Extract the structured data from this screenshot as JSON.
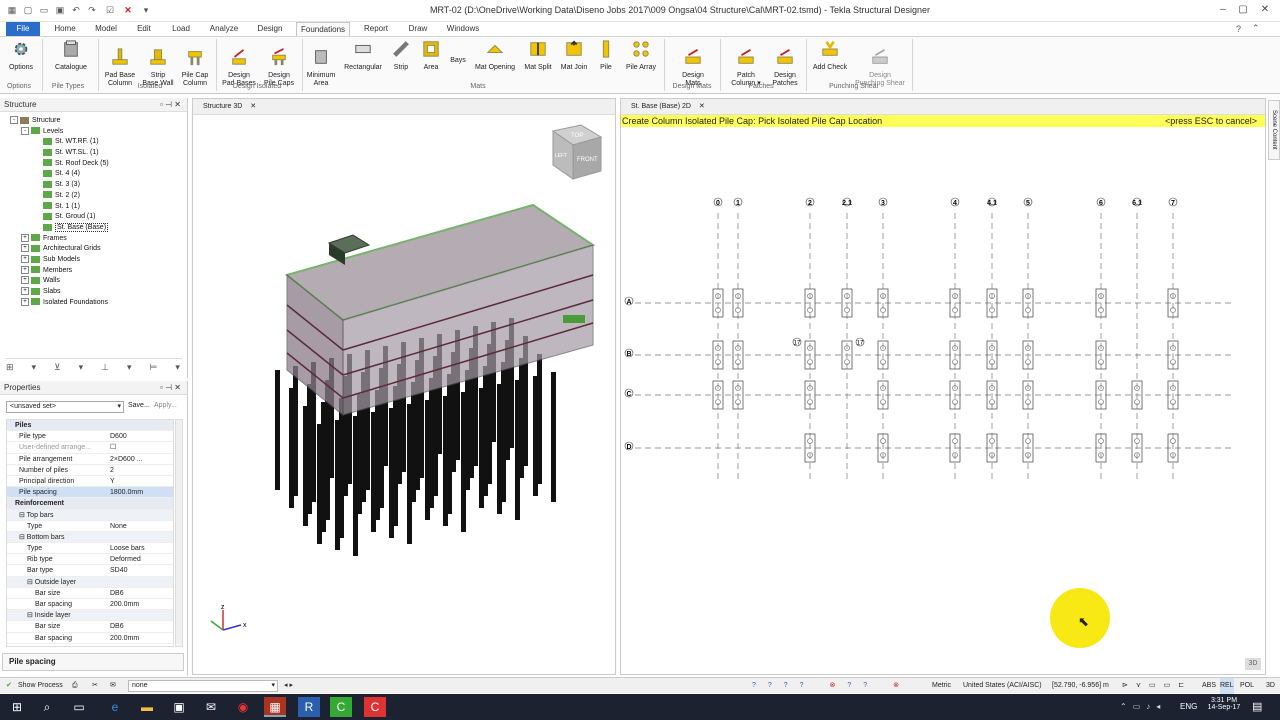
{
  "window": {
    "title": "MRT-02 (D:\\OneDrive\\Working Data\\Diseno Jobs 2017\\009 Ongsa\\04 Structure\\Cal\\MRT-02.tsmd) - Tekla Structural Designer"
  },
  "menu": {
    "tabs": [
      "File",
      "Home",
      "Model",
      "Edit",
      "Load",
      "Analyze",
      "Design",
      "Foundations",
      "Report",
      "Draw",
      "Windows"
    ],
    "active": "Foundations"
  },
  "ribbon": {
    "buttons": [
      {
        "label": "Options",
        "icon": "gear-icon"
      },
      {
        "label": "Catalogue",
        "icon": "catalogue-icon"
      },
      {
        "label": "Pad Base\nColumn",
        "icon": "pad-base-icon"
      },
      {
        "label": "Strip\nBase Wall",
        "icon": "strip-base-icon"
      },
      {
        "label": "Pile Cap\nColumn",
        "icon": "pile-cap-icon"
      },
      {
        "label": "Design\nPad Bases",
        "icon": "design-pad-icon"
      },
      {
        "label": "Design\nPile Caps",
        "icon": "design-pile-icon"
      },
      {
        "label": "Minimum\nArea",
        "icon": "minimum-area-icon"
      },
      {
        "label": "Rectangular",
        "icon": "rectangular-icon"
      },
      {
        "label": "Strip",
        "icon": "strip-icon"
      },
      {
        "label": "Area",
        "icon": "area-icon"
      },
      {
        "label": "Bays",
        "icon": "bays-icon"
      },
      {
        "label": "Mat Opening",
        "icon": "mat-opening-icon"
      },
      {
        "label": "Mat Split",
        "icon": "mat-split-icon"
      },
      {
        "label": "Mat Join",
        "icon": "mat-join-icon"
      },
      {
        "label": "Pile",
        "icon": "pile-icon"
      },
      {
        "label": "Pile Array",
        "icon": "pile-array-icon"
      },
      {
        "label": "Design\nMats",
        "icon": "design-mats-icon"
      },
      {
        "label": "Patch\nColumn ▾",
        "icon": "patch-column-icon"
      },
      {
        "label": "Design\nPatches",
        "icon": "design-patches-icon"
      },
      {
        "label": "Add Check",
        "icon": "add-check-icon"
      },
      {
        "label": "Design\nPunching Shear",
        "icon": "design-punching-icon"
      }
    ],
    "groups": [
      "Options",
      "Pile Types",
      "Isolated",
      "Design Isolated",
      "Mats",
      "Design Mats",
      "Patches",
      "Punching Shear"
    ]
  },
  "structure_panel": {
    "title": "Structure",
    "tree": [
      {
        "label": "Structure",
        "level": 0,
        "toggle": "-"
      },
      {
        "label": "Levels",
        "level": 1,
        "toggle": "-"
      },
      {
        "label": "St. WT.RF. (1)",
        "level": 2
      },
      {
        "label": "St. WT.SL. (1)",
        "level": 2
      },
      {
        "label": "St. Roof Deck (5)",
        "level": 2
      },
      {
        "label": "St. 4 (4)",
        "level": 2
      },
      {
        "label": "St. 3 (3)",
        "level": 2
      },
      {
        "label": "St. 2 (2)",
        "level": 2
      },
      {
        "label": "St. 1 (1)",
        "level": 2
      },
      {
        "label": "St. Groud (1)",
        "level": 2
      },
      {
        "label": "St. Base (Base)",
        "level": 2,
        "selected": true
      },
      {
        "label": "Frames",
        "level": 1,
        "toggle": "+"
      },
      {
        "label": "Architectural Grids",
        "level": 1,
        "toggle": "+"
      },
      {
        "label": "Sub Models",
        "level": 1,
        "toggle": "+"
      },
      {
        "label": "Members",
        "level": 1,
        "toggle": "+"
      },
      {
        "label": "Walls",
        "level": 1,
        "toggle": "+"
      },
      {
        "label": "Slabs",
        "level": 1,
        "toggle": "+"
      },
      {
        "label": "Isolated Foundations",
        "level": 1,
        "toggle": "+"
      }
    ]
  },
  "properties_panel": {
    "title": "Properties",
    "set_select": "<unsaved set>",
    "save_label": "Save...",
    "apply_label": "Apply...",
    "rows": [
      {
        "k": "Piles",
        "v": "",
        "type": "group"
      },
      {
        "k": "Pile type",
        "v": "D600"
      },
      {
        "k": "User-defined arrange...",
        "v": "☐",
        "muted": true
      },
      {
        "k": "Pile arrangement",
        "v": "2×D600 ..."
      },
      {
        "k": "Number of piles",
        "v": "2"
      },
      {
        "k": "Principal direction",
        "v": "Y"
      },
      {
        "k": "Pile spacing",
        "v": "1800.0mm",
        "selected": true
      },
      {
        "k": "Reinforcement",
        "v": "",
        "type": "group"
      },
      {
        "k": "⊟ Top bars",
        "v": "",
        "type": "sub"
      },
      {
        "k": "Type",
        "v": "None",
        "indent": 1
      },
      {
        "k": "⊟ Bottom bars",
        "v": "",
        "type": "sub"
      },
      {
        "k": "Type",
        "v": "Loose bars",
        "indent": 1
      },
      {
        "k": "Rib type",
        "v": "Deformed",
        "indent": 1
      },
      {
        "k": "Bar type",
        "v": "SD40",
        "indent": 1
      },
      {
        "k": "⊟ Outside layer",
        "v": "",
        "type": "sub",
        "indent": 1
      },
      {
        "k": "Bar size",
        "v": "DB6",
        "indent": 2
      },
      {
        "k": "Bar spacing",
        "v": "200.0mm",
        "indent": 2
      },
      {
        "k": "⊟ Inside layer",
        "v": "",
        "type": "sub",
        "indent": 1
      },
      {
        "k": "Bar size",
        "v": "DB6",
        "indent": 2
      },
      {
        "k": "Bar spacing",
        "v": "200.0mm",
        "indent": 2
      }
    ],
    "footer": "Pile spacing"
  },
  "view3d": {
    "tab": "Structure 3D",
    "cube_top": "TOP",
    "cube_front": "FRONT",
    "cube_left": "LEFT"
  },
  "view2d": {
    "tab": "St. Base (Base) 2D",
    "command": "Create Column Isolated Pile Cap: Pick Isolated Pile Cap Location",
    "esc_hint": "<press ESC to cancel>",
    "grid_x": [
      "0",
      "1",
      "2",
      "2.1",
      "3",
      "4",
      "4.1",
      "5",
      "6",
      "6.1",
      "7"
    ],
    "grid_y": [
      "A",
      "B",
      "C",
      "D"
    ],
    "extra_label": "17",
    "badge": "3D"
  },
  "scene_content_label": "Scene Content",
  "statusbar": {
    "show_process": "Show Process",
    "filter_value": "none",
    "units": "Metric",
    "code": "United States (ACI/AISC)",
    "coords": "[52.790, -6.956] m",
    "modes": [
      "ABS",
      "REL",
      "POL",
      "3D"
    ]
  },
  "taskbar": {
    "time": "3:31 PM",
    "date": "14-Sep-17",
    "lang": "ENG"
  },
  "colors": {
    "accent": "#2b6ec9",
    "command_bar": "#ffff5a",
    "highlight": "#f7e600"
  }
}
